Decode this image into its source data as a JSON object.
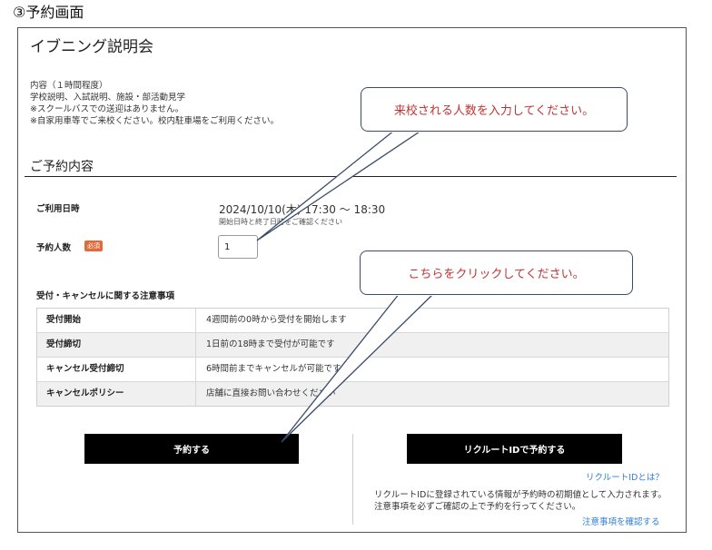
{
  "doc_heading": "③予約画面",
  "event_title": "イブニング説明会",
  "description_lines": [
    "内容（１時間程度）",
    "学校説明、入試説明、施設・部活動見学",
    "※スクールバスでの送迎はありません。",
    "※自家用車等でご来校ください。校内駐車場をご利用ください。"
  ],
  "section_title": "ご予約内容",
  "date": {
    "label": "ご利用日時",
    "value": "2024/10/10(木) 17:30 〜 18:30",
    "note": "開始日時と終了日時をご確認ください"
  },
  "count": {
    "label": "予約人数",
    "required_badge": "必須",
    "value": "1"
  },
  "notice_table": {
    "title": "受付・キャンセルに関する注意事項",
    "rows": [
      {
        "header": "受付開始",
        "value": "4週間前の0時から受付を開始します"
      },
      {
        "header": "受付締切",
        "value": "1日前の18時まで受付が可能です"
      },
      {
        "header": "キャンセル受付締切",
        "value": "6時間前までキャンセルが可能です"
      },
      {
        "header": "キャンセルポリシー",
        "value": "店舗に直接お問い合わせください"
      }
    ]
  },
  "buttons": {
    "reserve": "予約する",
    "recruit_reserve": "リクルートIDで予約する"
  },
  "recruit": {
    "what_link": "リクルートIDとは？",
    "note": "リクルートIDに登録されている情報が予約時の初期値として入力されます。注意事項を必ずご確認の上で予約を行ってください。",
    "notice_link": "注意事項を確認する"
  },
  "callouts": {
    "enter_count": "来校される人数を入力してください。",
    "click_here": "こちらをクリックしてください。"
  },
  "colors": {
    "callout_text": "#c23333",
    "callout_border": "#3a4b6a",
    "link": "#2e7dd6",
    "button_bg": "#000000",
    "required_badge": "#e06a3a"
  }
}
